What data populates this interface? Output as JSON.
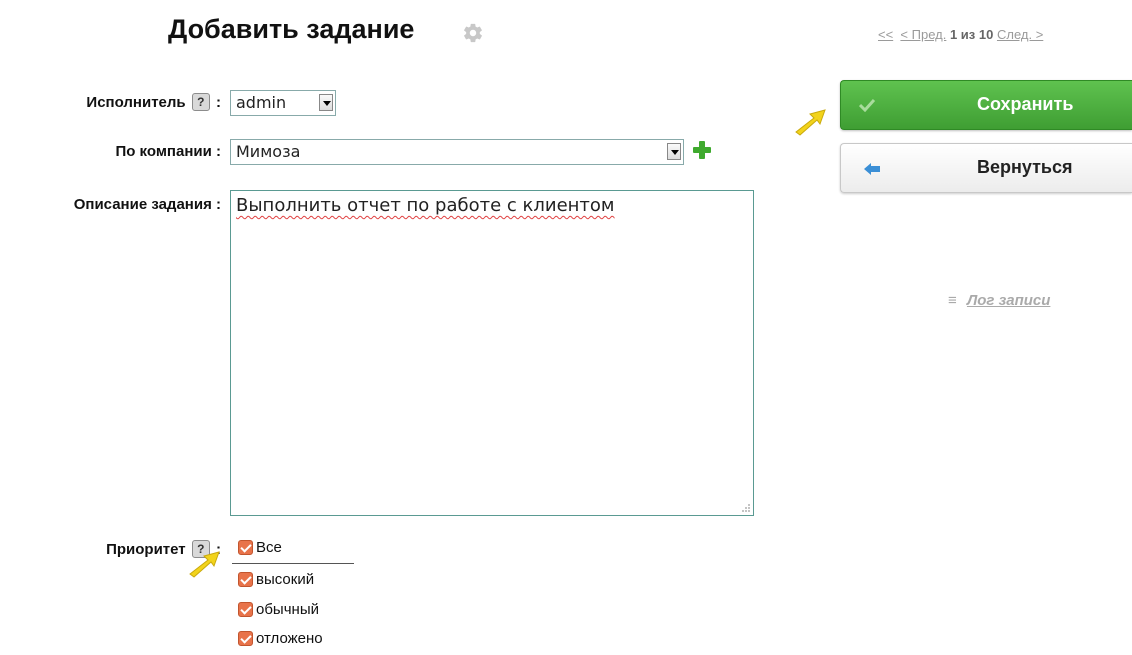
{
  "page": {
    "title": "Добавить задание"
  },
  "pager": {
    "first": "<<",
    "prev": "< Пред.",
    "count": "1 из 10",
    "next": "След. >"
  },
  "form": {
    "executor": {
      "label": "Исполнитель",
      "help": "?",
      "colon": ":",
      "value": "admin"
    },
    "company": {
      "label": "По компании :",
      "value": "Мимоза"
    },
    "description": {
      "label": "Описание задания :",
      "value": "Выполнить отчет по работе с клиентом"
    },
    "priority": {
      "label": "Приоритет",
      "help": "?",
      "colon": ":",
      "options": [
        {
          "label": "Все",
          "checked": true
        },
        {
          "label": "высокий",
          "checked": true
        },
        {
          "label": "обычный",
          "checked": true
        },
        {
          "label": "отложено",
          "checked": true
        }
      ]
    }
  },
  "actions": {
    "save_label": "Сохранить",
    "back_label": "Вернуться",
    "log_label": "Лог записи",
    "log_icon": "≡"
  },
  "colors": {
    "save": "#4aae3c",
    "accent_checkbox": "#e8734a",
    "pointer": "#f2d31b"
  }
}
